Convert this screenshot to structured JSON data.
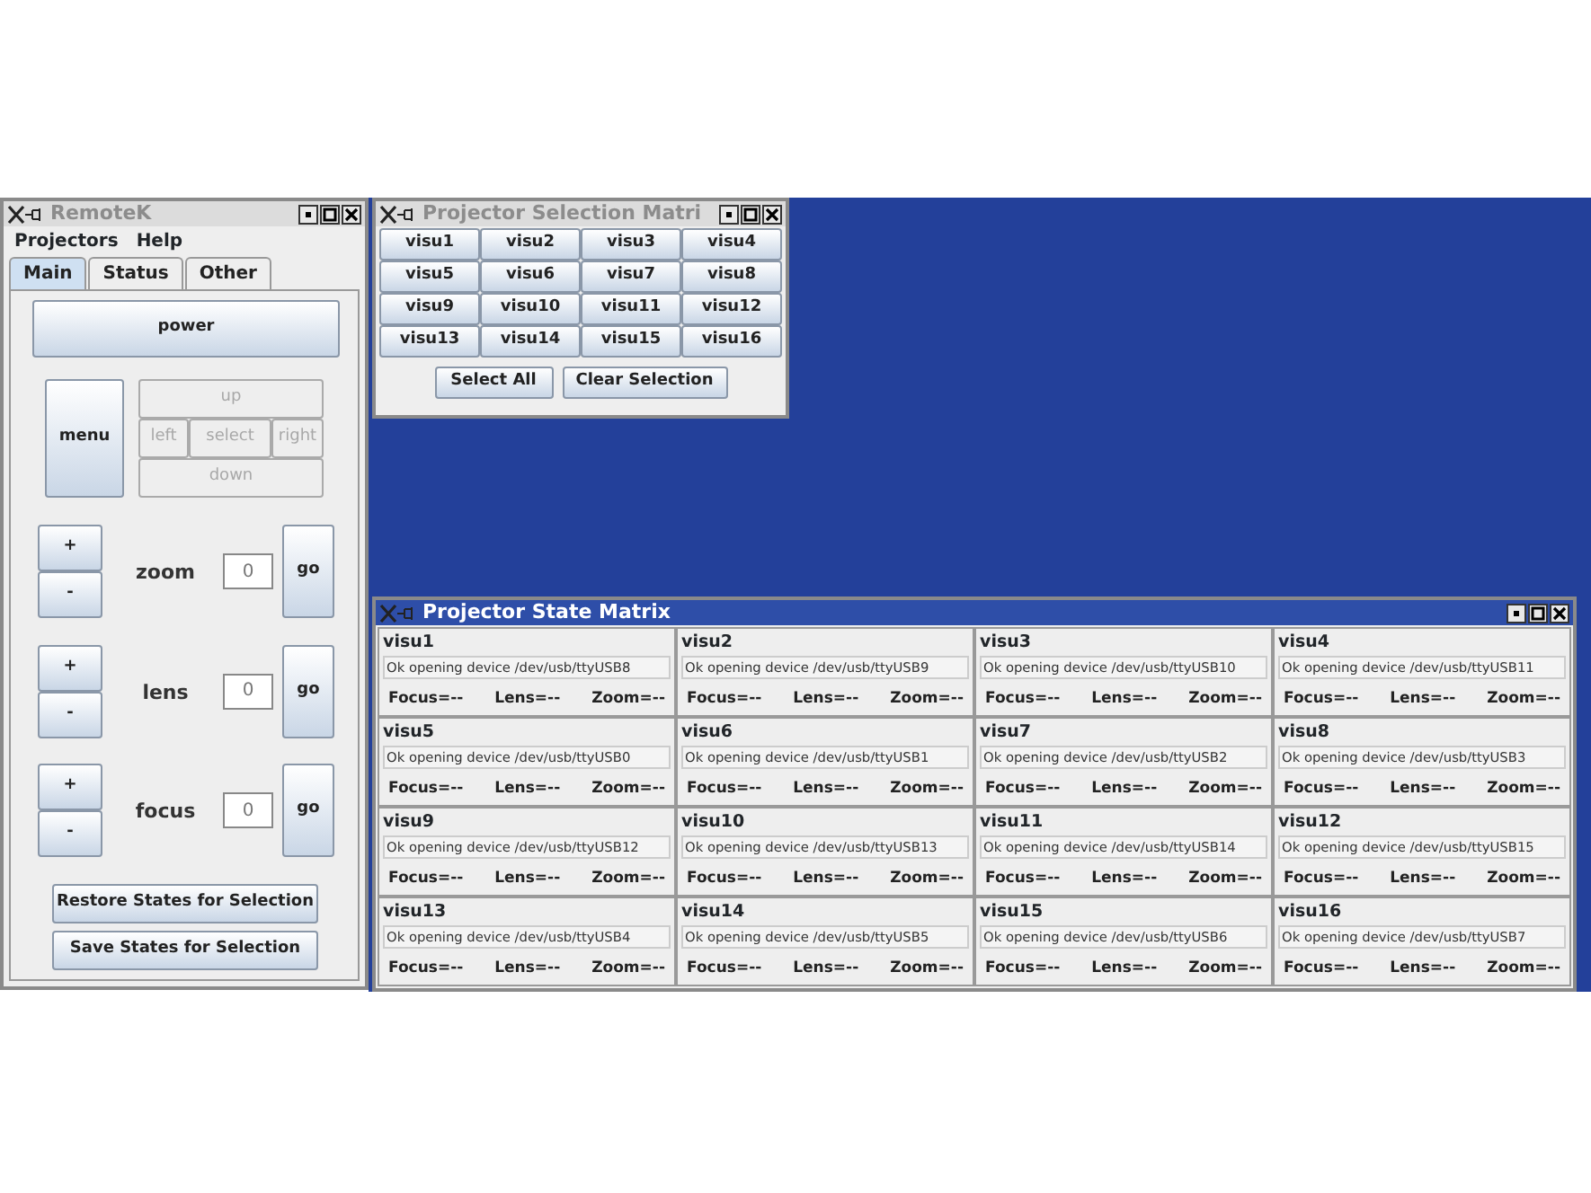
{
  "remote_window": {
    "title": "RemoteK",
    "active": false,
    "menu": [
      "Projectors",
      "Help"
    ],
    "tabs": [
      {
        "label": "Main",
        "selected": true
      },
      {
        "label": "Status",
        "selected": false
      },
      {
        "label": "Other",
        "selected": false
      }
    ],
    "power_button": "power",
    "menu_button": "menu",
    "direction_pad": [
      {
        "kind": "up",
        "label": "up",
        "disabled": true
      },
      {
        "kind": "left",
        "label": "left",
        "disabled": true
      },
      {
        "kind": "select",
        "label": "select",
        "disabled": true
      },
      {
        "kind": "right",
        "label": "right",
        "disabled": true
      },
      {
        "kind": "down",
        "label": "down",
        "disabled": true
      }
    ],
    "adjusters": [
      {
        "plus": "+",
        "minus": "-",
        "label": "zoom",
        "value": "0",
        "go": "go"
      },
      {
        "plus": "+",
        "minus": "-",
        "label": "lens",
        "value": "0",
        "go": "go"
      },
      {
        "plus": "+",
        "minus": "-",
        "label": "focus",
        "value": "0",
        "go": "go"
      }
    ],
    "actions": [
      "Restore States for Selection",
      "Save States for Selection"
    ]
  },
  "selection_window": {
    "title": "Projector Selection Matri",
    "active": false,
    "projectors": [
      "visu1",
      "visu2",
      "visu3",
      "visu4",
      "visu5",
      "visu6",
      "visu7",
      "visu8",
      "visu9",
      "visu10",
      "visu11",
      "visu12",
      "visu13",
      "visu14",
      "visu15",
      "visu16"
    ],
    "buttons": [
      "Select All",
      "Clear Selection"
    ]
  },
  "state_window": {
    "title": "Projector State Matrix",
    "active": true,
    "cells": [
      {
        "name": "visu1",
        "message": "Ok opening device /dev/usb/ttyUSB8",
        "readings": [
          "Focus=--",
          "Lens=--",
          "Zoom=--"
        ]
      },
      {
        "name": "visu2",
        "message": "Ok opening device /dev/usb/ttyUSB9",
        "readings": [
          "Focus=--",
          "Lens=--",
          "Zoom=--"
        ]
      },
      {
        "name": "visu3",
        "message": "Ok opening device /dev/usb/ttyUSB10",
        "readings": [
          "Focus=--",
          "Lens=--",
          "Zoom=--"
        ]
      },
      {
        "name": "visu4",
        "message": "Ok opening device /dev/usb/ttyUSB11",
        "readings": [
          "Focus=--",
          "Lens=--",
          "Zoom=--"
        ]
      },
      {
        "name": "visu5",
        "message": "Ok opening device /dev/usb/ttyUSB0",
        "readings": [
          "Focus=--",
          "Lens=--",
          "Zoom=--"
        ]
      },
      {
        "name": "visu6",
        "message": "Ok opening device /dev/usb/ttyUSB1",
        "readings": [
          "Focus=--",
          "Lens=--",
          "Zoom=--"
        ]
      },
      {
        "name": "visu7",
        "message": "Ok opening device /dev/usb/ttyUSB2",
        "readings": [
          "Focus=--",
          "Lens=--",
          "Zoom=--"
        ]
      },
      {
        "name": "visu8",
        "message": "Ok opening device /dev/usb/ttyUSB3",
        "readings": [
          "Focus=--",
          "Lens=--",
          "Zoom=--"
        ]
      },
      {
        "name": "visu9",
        "message": "Ok opening device /dev/usb/ttyUSB12",
        "readings": [
          "Focus=--",
          "Lens=--",
          "Zoom=--"
        ]
      },
      {
        "name": "visu10",
        "message": "Ok opening device /dev/usb/ttyUSB13",
        "readings": [
          "Focus=--",
          "Lens=--",
          "Zoom=--"
        ]
      },
      {
        "name": "visu11",
        "message": "Ok opening device /dev/usb/ttyUSB14",
        "readings": [
          "Focus=--",
          "Lens=--",
          "Zoom=--"
        ]
      },
      {
        "name": "visu12",
        "message": "Ok opening device /dev/usb/ttyUSB15",
        "readings": [
          "Focus=--",
          "Lens=--",
          "Zoom=--"
        ]
      },
      {
        "name": "visu13",
        "message": "Ok opening device /dev/usb/ttyUSB4",
        "readings": [
          "Focus=--",
          "Lens=--",
          "Zoom=--"
        ]
      },
      {
        "name": "visu14",
        "message": "Ok opening device /dev/usb/ttyUSB5",
        "readings": [
          "Focus=--",
          "Lens=--",
          "Zoom=--"
        ]
      },
      {
        "name": "visu15",
        "message": "Ok opening device /dev/usb/ttyUSB6",
        "readings": [
          "Focus=--",
          "Lens=--",
          "Zoom=--"
        ]
      },
      {
        "name": "visu16",
        "message": "Ok opening device /dev/usb/ttyUSB7",
        "readings": [
          "Focus=--",
          "Lens=--",
          "Zoom=--"
        ]
      }
    ]
  }
}
